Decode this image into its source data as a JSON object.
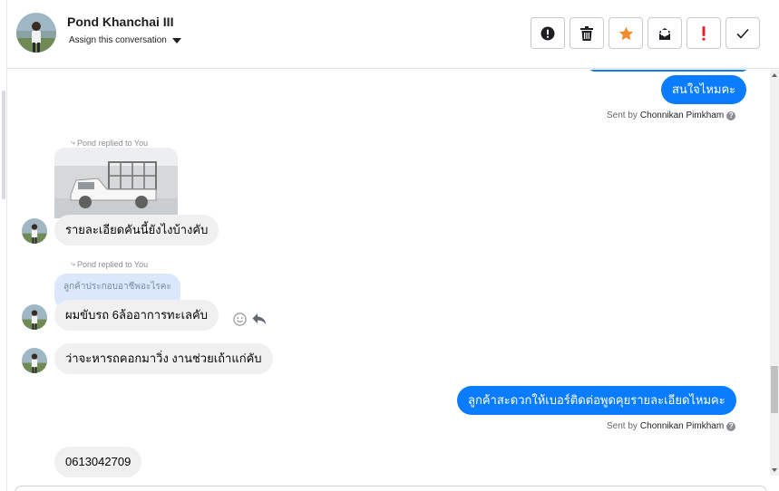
{
  "header": {
    "contact_name": "Pond Khanchai III",
    "assign_label": "Assign this conversation",
    "toolbar": [
      {
        "name": "spam-alert-button",
        "icon": "alert-circle-icon"
      },
      {
        "name": "delete-button",
        "icon": "trash-icon"
      },
      {
        "name": "star-button",
        "icon": "star-icon"
      },
      {
        "name": "mark-unread-button",
        "icon": "envelope-icon"
      },
      {
        "name": "flag-button",
        "icon": "exclamation-icon"
      },
      {
        "name": "mark-done-button",
        "icon": "check-icon"
      }
    ]
  },
  "colors": {
    "outgoing_bubble": "#0a7cff",
    "incoming_bubble": "#f0f0f0",
    "quote_bubble": "#dbe8fb",
    "star": "#f28a2b",
    "flag": "#e4222b"
  },
  "messages": {
    "m1": {
      "text": "สนใจไหมคะ",
      "sent_by_prefix": "Sent by",
      "sent_by_name": "Chonnikan Pimkham"
    },
    "m2": {
      "replied_label": "Pond replied to You",
      "text": "รายละเอียดคันนี้ยังไงบ้างคับ"
    },
    "m3": {
      "replied_label": "Pond replied to You",
      "quoted": "ลูกค้าประกอบอาชีพอะไรคะ",
      "text": "ผมขับรถ 6ล้ออาการทะเลคับ"
    },
    "m4": {
      "text": "ว่าจะหารถคอกมาวิ่ง งานช่วยเถ้าแก่คับ"
    },
    "m5": {
      "text": "ลูกค้าสะดวกให้เบอร์ติดต่อพูดคุยรายละเอียดไหมคะ",
      "sent_by_prefix": "Sent by",
      "sent_by_name": "Chonnikan Pimkham"
    },
    "m6": {
      "text": "0613042709"
    }
  }
}
